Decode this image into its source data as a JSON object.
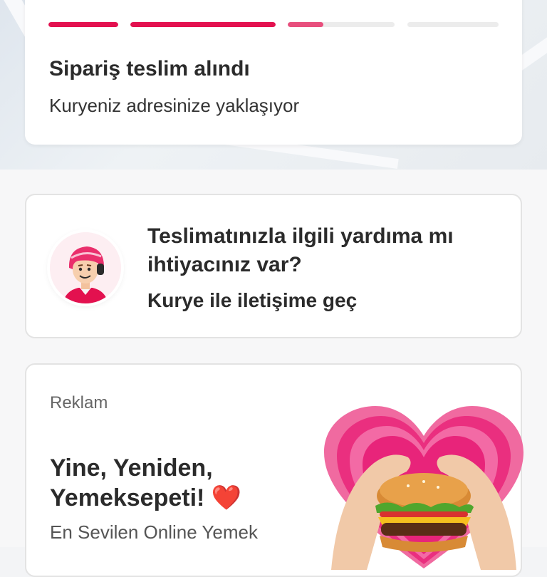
{
  "status": {
    "title": "Sipariş teslim alındı",
    "subtitle": "Kuryeniz adresinize yaklaşıyor",
    "steps": [
      1,
      1,
      0.3,
      0
    ]
  },
  "help": {
    "title": "Teslimatınızla ilgili yardıma mı ihtiyacınız var?",
    "link": "Kurye ile iletişime geç",
    "avatar_icon": "courier-avatar-icon"
  },
  "ad": {
    "label": "Reklam",
    "title": "Yine, Yeniden, Yemeksepeti!",
    "emoji": "❤️",
    "subtitle": "En Sevilen Online Yemek",
    "image_icon": "heart-hands-burger-image"
  },
  "colors": {
    "accent": "#e3114f",
    "accent_light": "#e84f7d",
    "track": "#ececec"
  }
}
